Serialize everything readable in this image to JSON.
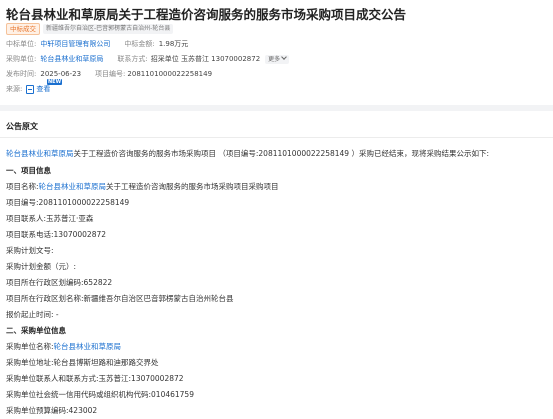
{
  "header": {
    "title": "轮台县林业和草原局关于工程造价咨询服务的服务市场采购项目成交公告",
    "tags": [
      "中标成交",
      "新疆维吾尔自治区-巴音郭楞蒙古自治州-轮台县"
    ]
  },
  "meta": {
    "winner_label": "中标单位:",
    "winner_value": "中轩项目管理有限公司",
    "amount_label": "中标金额:",
    "amount_value": "1.98万元",
    "purchaser_label": "采购单位:",
    "purchaser_value": "轮台县林业和草原局",
    "contact_label": "联系方式:",
    "contact_value": "招采单位 玉苏普江 13070002872",
    "more_label": "更多",
    "date_label": "发布时间:",
    "date_value": "2025-06-23",
    "project_no_label": "项目编号:",
    "project_no_value": "2081101000022258149",
    "source_label": "来源:",
    "source_link": "查看",
    "new_badge": "NEW"
  },
  "section": {
    "heading": "公告原文"
  },
  "body": {
    "intro_link": "轮台县林业和草原局",
    "intro_text": "关于工程造价咨询服务的服务市场采购项目 （项目编号:2081101000022258149 ）采购已经结束，现将采购结果公示如下:",
    "h1": "一、项目信息",
    "p1_prefix": "项目名称:",
    "p1_link": "轮台县林业和草原局",
    "p1_suffix": "关于工程造价咨询服务的服务市场采购项目采购项目",
    "p2": "项目编号:2081101000022258149",
    "p3": "项目联系人:玉苏普江·亚森",
    "p4": "项目联系电话:13070002872",
    "p5": "采购计划文号:",
    "p6": "采购计划金额（元）:",
    "p7": "项目所在行政区划编码:652822",
    "p8": "项目所在行政区划名称:新疆维吾尔自治区巴音郭楞蒙古自治州轮台县",
    "p9": "报价起止时间: -",
    "h2": "二、采购单位信息",
    "q1_prefix": "采购单位名称:",
    "q1_link": "轮台县林业和草原局",
    "q2": "采购单位地址:轮台县博斯坦路和迪那路交界处",
    "q3": "采购单位联系人和联系方式:玉苏普江:13070002872",
    "q4": "采购单位社会统一信用代码或组织机构代码:010461759",
    "q5": "采购单位预算编码:423002"
  }
}
